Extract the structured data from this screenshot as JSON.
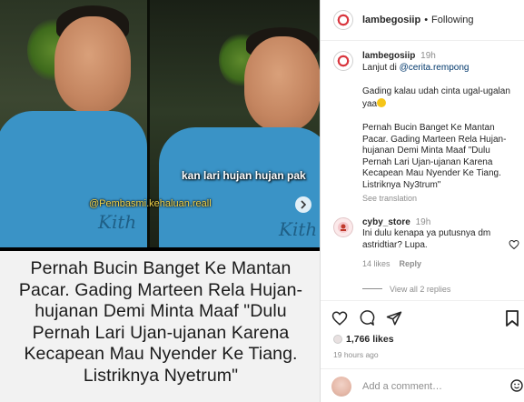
{
  "video": {
    "credit": "@Pembasmi.kehaluan.reall",
    "subtitle": "kan lari hujan hujan pak",
    "shirt_brand": "Kith"
  },
  "caption_card": {
    "text": "Pernah Bucin Banget Ke Mantan Pacar. Gading Marteen Rela Hujan-hujanan Demi Minta Maaf \"Dulu Pernah Lari Ujan-ujanan Karena Kecapean Mau Nyender Ke Tiang. Listriknya Nyetrum\""
  },
  "header": {
    "username": "lambegosiip",
    "separator": "•",
    "follow_status": "Following"
  },
  "post": {
    "username": "lambegosiip",
    "time": "19h",
    "line1_prefix": "Lanjut di ",
    "mention": "@cerita.rempong",
    "para2": "Gading kalau udah cinta ugal-ugalan yaa",
    "para3": "Pernah Bucin Banget Ke Mantan Pacar. Gading Marteen Rela Hujan-hujanan Demi Minta Maaf \"Dulu Pernah Lari Ujan-ujanan Karena Kecapean Mau Nyender Ke Tiang. Listriknya Ny3trum\"",
    "see_translation": "See translation"
  },
  "comment": {
    "username": "cyby_store",
    "time": "19h",
    "text": "Ini dulu kenapa ya putusnya dm astridtiar? Lupa.",
    "likes": "14 likes",
    "reply": "Reply",
    "view_replies": "View all 2 replies"
  },
  "actions": {
    "likes": "1,766 likes",
    "posted_ago": "19 hours ago",
    "add_comment_placeholder": "Add a comment…"
  },
  "colors": {
    "accent_link": "#00376b",
    "muted": "#8e8e8e",
    "subtitle_yellow": "#f0d24a",
    "shirt_blue": "#3a93c6"
  }
}
